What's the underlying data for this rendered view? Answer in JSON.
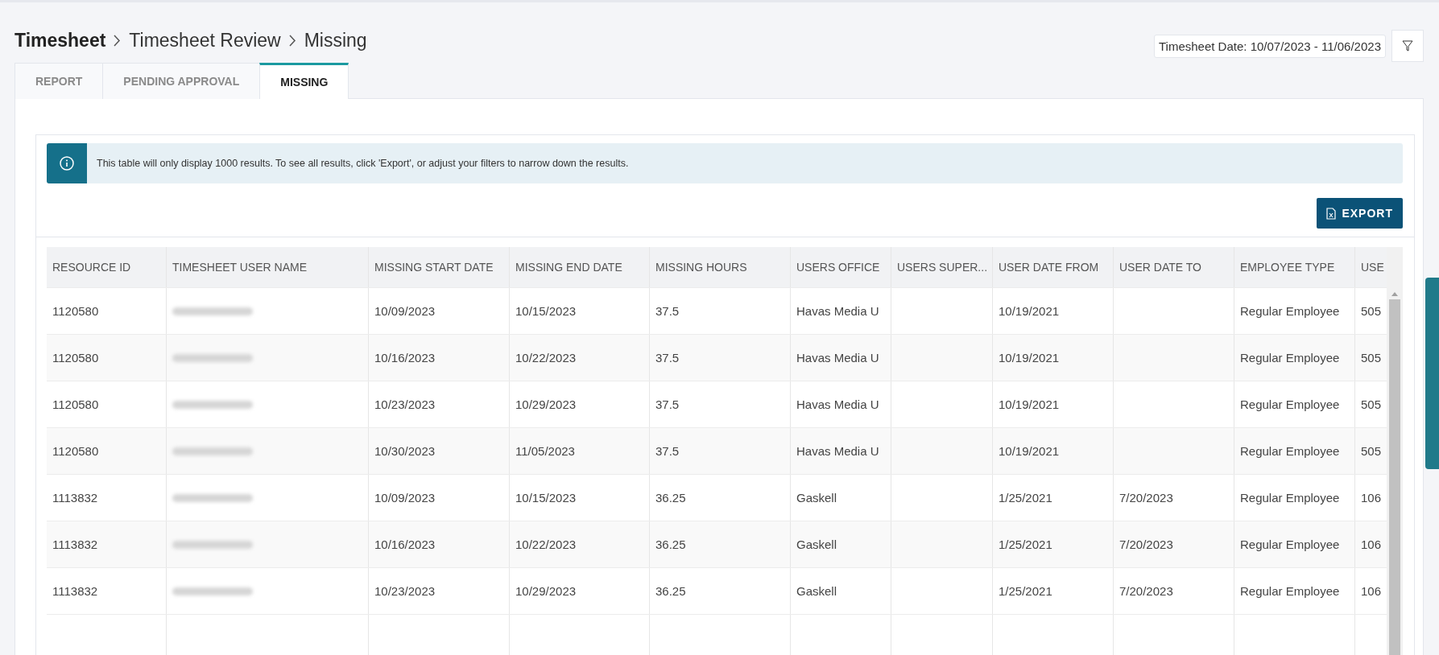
{
  "breadcrumb": [
    "Timesheet",
    "Timesheet Review",
    "Missing"
  ],
  "date_range": "Timesheet Date: 10/07/2023 - 11/06/2023",
  "tabs": [
    {
      "label": "REPORT",
      "selected": false
    },
    {
      "label": "PENDING APPROVAL",
      "selected": false
    },
    {
      "label": "MISSING",
      "selected": true
    }
  ],
  "info_banner": "This table will only display 1000 results. To see all results, click 'Export', or adjust your filters to narrow down the results.",
  "export_button": "EXPORT",
  "table": {
    "columns": [
      "RESOURCE ID",
      "TIMESHEET USER NAME",
      "MISSING START DATE",
      "MISSING END DATE",
      "MISSING HOURS",
      "USERS OFFICE",
      "USERS SUPER...",
      "USER DATE FROM",
      "USER DATE TO",
      "EMPLOYEE TYPE",
      "USE"
    ],
    "rows": [
      {
        "cells": [
          "1120580",
          null,
          "10/09/2023",
          "10/15/2023",
          "37.5",
          "Havas Media U",
          "",
          "10/19/2021",
          "",
          "Regular Employee",
          "505"
        ]
      },
      {
        "cells": [
          "1120580",
          null,
          "10/16/2023",
          "10/22/2023",
          "37.5",
          "Havas Media U",
          "",
          "10/19/2021",
          "",
          "Regular Employee",
          "505"
        ]
      },
      {
        "cells": [
          "1120580",
          null,
          "10/23/2023",
          "10/29/2023",
          "37.5",
          "Havas Media U",
          "",
          "10/19/2021",
          "",
          "Regular Employee",
          "505"
        ]
      },
      {
        "cells": [
          "1120580",
          null,
          "10/30/2023",
          "11/05/2023",
          "37.5",
          "Havas Media U",
          "",
          "10/19/2021",
          "",
          "Regular Employee",
          "505"
        ]
      },
      {
        "cells": [
          "1113832",
          null,
          "10/09/2023",
          "10/15/2023",
          "36.25",
          "Gaskell",
          "",
          "1/25/2021",
          "7/20/2023",
          "Regular Employee",
          "106"
        ]
      },
      {
        "cells": [
          "1113832",
          null,
          "10/16/2023",
          "10/22/2023",
          "36.25",
          "Gaskell",
          "",
          "1/25/2021",
          "7/20/2023",
          "Regular Employee",
          "106"
        ]
      },
      {
        "cells": [
          "1113832",
          null,
          "10/23/2023",
          "10/29/2023",
          "36.25",
          "Gaskell",
          "",
          "1/25/2021",
          "7/20/2023",
          "Regular Employee",
          "106"
        ]
      }
    ]
  }
}
